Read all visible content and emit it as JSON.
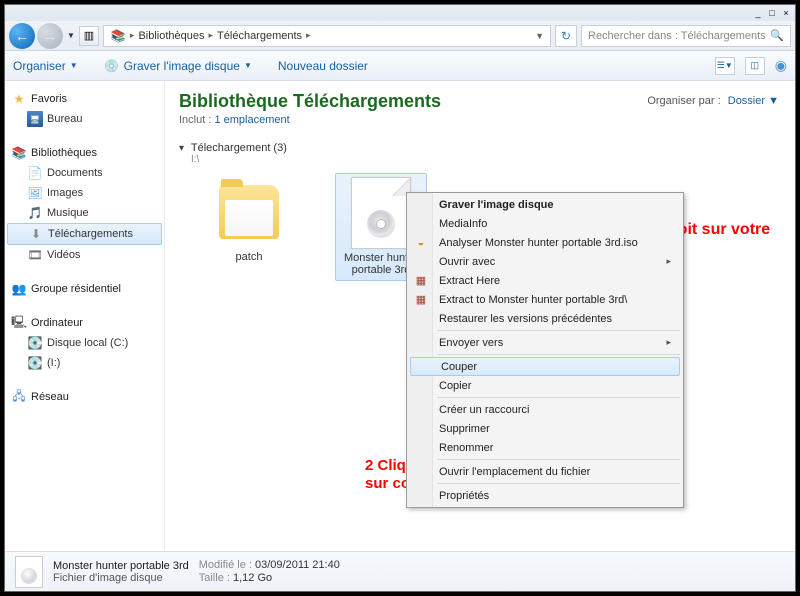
{
  "titlebar": {
    "min": "_",
    "max": "□",
    "close": "×"
  },
  "breadcrumb": {
    "item1": "Bibliothèques",
    "item2": "Téléchargements"
  },
  "search": {
    "placeholder": "Rechercher dans : Téléchargements"
  },
  "toolbar": {
    "organiser": "Organiser",
    "graver": "Graver l'image disque",
    "nouveau": "Nouveau dossier"
  },
  "sidebar": {
    "favoris": {
      "head": "Favoris",
      "bureau": "Bureau"
    },
    "biblio": {
      "head": "Bibliothèques",
      "docs": "Documents",
      "imgs": "Images",
      "mus": "Musique",
      "dl": "Téléchargements",
      "vid": "Vidéos"
    },
    "groupe": "Groupe résidentiel",
    "ordi": {
      "head": "Ordinateur",
      "c": "Disque local (C:)",
      "i": "(I:)"
    },
    "reseau": "Réseau"
  },
  "header": {
    "title": "Bibliothèque Téléchargements",
    "sublabel": "Inclut :",
    "sublink": "1 emplacement",
    "orgby_label": "Organiser par :",
    "orgby_value": "Dossier"
  },
  "folder": {
    "name": "Télechargement (3)",
    "path": "I:\\"
  },
  "files": {
    "patch": "patch",
    "iso": "Monster hunter portable 3rd"
  },
  "context": {
    "graver": "Graver l'image disque",
    "mediainfo": "MediaInfo",
    "analyser": "Analyser Monster hunter portable 3rd.iso",
    "ouvrir_avec": "Ouvrir avec",
    "extract_here": "Extract Here",
    "extract_to": "Extract to Monster hunter portable 3rd\\",
    "restaurer": "Restaurer les versions précédentes",
    "envoyer": "Envoyer vers",
    "couper": "Couper",
    "copier": "Copier",
    "raccourci": "Créer un raccourci",
    "supprimer": "Supprimer",
    "renommer": "Renommer",
    "ouvrir_empl": "Ouvrir l'emplacement du fichier",
    "proprietes": "Propriétés"
  },
  "annotations": {
    "a1": "1 Clique droit sur votre iso",
    "a2_l1": "2 Cliquer ensuite",
    "a2_l2": "sur couper"
  },
  "status": {
    "name": "Monster hunter portable 3rd",
    "type": "Fichier d'image disque",
    "mod_label": "Modifié le :",
    "mod_val": "03/09/2011 21:40",
    "size_label": "Taille :",
    "size_val": "1,12 Go"
  }
}
